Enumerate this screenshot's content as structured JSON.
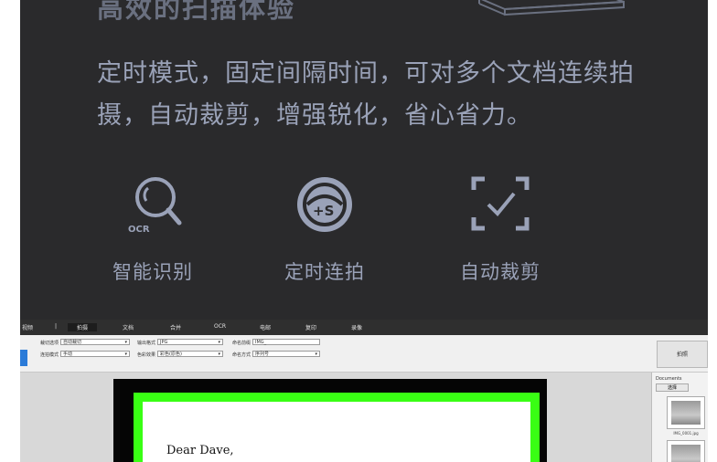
{
  "banner": {
    "headline": "高效的扫描体验",
    "description": "定时模式，固定间隔时间，可对多个文档连续拍摄，自动裁剪，增强锐化，省心省力。",
    "features": [
      {
        "label": "智能识别",
        "icon": "ocr-magnifier-icon",
        "icon_text": "OCR"
      },
      {
        "label": "定时连拍",
        "icon": "timer-shot-icon",
        "icon_text": "+S"
      },
      {
        "label": "自动裁剪",
        "icon": "crop-check-icon"
      }
    ],
    "colors": {
      "background": "#2a2a2c",
      "text": "#9aa2b8",
      "accent_green": "#39ff14"
    }
  },
  "app": {
    "menu": [
      "拍摄",
      "文档",
      "合并",
      "OCR",
      "电邮",
      "复印",
      "录像"
    ],
    "menu_left": "视频",
    "toolbar": {
      "row1": [
        {
          "label": "裁切选项",
          "value": "自动裁切"
        },
        {
          "label": "输出格式",
          "value": "JPG"
        },
        {
          "label": "命名前缀",
          "value": "IMG_"
        }
      ],
      "row2": [
        {
          "label": "连拍模式",
          "value": "手动"
        },
        {
          "label": "色彩效果",
          "value": "彩色(原色)"
        },
        {
          "label": "命名方式",
          "value": "序列号"
        }
      ]
    },
    "shoot_button": "拍照",
    "sidebar": {
      "title": "Documents",
      "select_button": "选择",
      "thumb_caption": "IMG_0001.jpg"
    },
    "document_text": "Dear Dave,"
  }
}
